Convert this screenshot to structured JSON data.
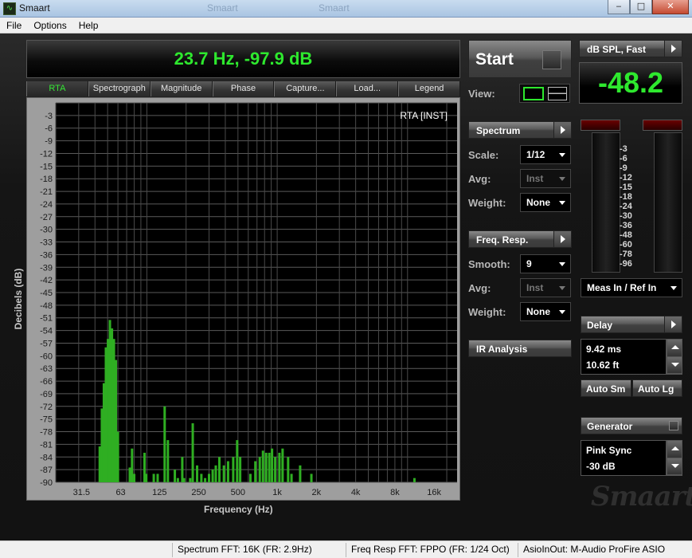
{
  "window": {
    "title": "Smaart",
    "ghost_tabs": [
      "Smaart",
      "Smaart"
    ]
  },
  "menu": [
    "File",
    "Options",
    "Help"
  ],
  "readout": "23.7 Hz, -97.9 dB",
  "tabs": [
    "RTA",
    "Spectrograph",
    "Magnitude",
    "Phase",
    "Capture...",
    "Load...",
    "Legend"
  ],
  "plot": {
    "title": "RTA [INST]",
    "ylabel": "Decibels (dB)",
    "xlabel": "Frequency (Hz)"
  },
  "chart_data": {
    "type": "bar",
    "title": "RTA [INST]",
    "xlabel": "Frequency (Hz)",
    "ylabel": "Decibels (dB)",
    "x_scale": "log",
    "xlim": [
      20,
      24000
    ],
    "ylim": [
      -90,
      0
    ],
    "x_ticks": [
      "31.5",
      "63",
      "125",
      "250",
      "500",
      "1k",
      "2k",
      "4k",
      "8k",
      "16k"
    ],
    "y_ticks": [
      "-3",
      "-6",
      "-9",
      "-12",
      "-15",
      "-18",
      "-21",
      "-24",
      "-27",
      "-30",
      "-33",
      "-36",
      "-39",
      "-42",
      "-45",
      "-48",
      "-51",
      "-54",
      "-57",
      "-60",
      "-63",
      "-66",
      "-69",
      "-72",
      "-75",
      "-78",
      "-81",
      "-84",
      "-87",
      "-90"
    ],
    "grid": true,
    "color": "#2fae22",
    "bars": [
      [
        43.5,
        -81.5
      ],
      [
        45.2,
        -72.5
      ],
      [
        46.8,
        -66.5
      ],
      [
        48.5,
        -58
      ],
      [
        50.3,
        -56
      ],
      [
        52.1,
        -51.5
      ],
      [
        54,
        -53.5
      ],
      [
        55.9,
        -56
      ],
      [
        57.9,
        -61
      ],
      [
        60,
        -78
      ],
      [
        74,
        -86.5
      ],
      [
        77,
        -82
      ],
      [
        80,
        -88
      ],
      [
        96,
        -83
      ],
      [
        99,
        -88
      ],
      [
        113,
        -88
      ],
      [
        121,
        -88
      ],
      [
        137,
        -72
      ],
      [
        145,
        -80
      ],
      [
        164,
        -87
      ],
      [
        173,
        -89
      ],
      [
        187,
        -84
      ],
      [
        193,
        -89
      ],
      [
        215,
        -89
      ],
      [
        225,
        -76
      ],
      [
        243,
        -86
      ],
      [
        262,
        -88
      ],
      [
        280,
        -89
      ],
      [
        300,
        -88
      ],
      [
        320,
        -87
      ],
      [
        338,
        -86
      ],
      [
        360,
        -84
      ],
      [
        390,
        -86
      ],
      [
        420,
        -85
      ],
      [
        460,
        -84
      ],
      [
        493,
        -80
      ],
      [
        520,
        -84
      ],
      [
        623,
        -88
      ],
      [
        680,
        -85
      ],
      [
        735,
        -84
      ],
      [
        778,
        -82.5
      ],
      [
        823,
        -83
      ],
      [
        870,
        -83
      ],
      [
        913,
        -82
      ],
      [
        965,
        -84
      ],
      [
        1040,
        -83
      ],
      [
        1100,
        -82
      ],
      [
        1213,
        -84
      ],
      [
        1288,
        -88
      ],
      [
        1500,
        -86
      ],
      [
        1830,
        -88
      ],
      [
        11300,
        -89
      ]
    ]
  },
  "controls": {
    "start_label": "Start",
    "view_label": "View:",
    "spectrum_label": "Spectrum",
    "scale_label": "Scale:",
    "scale_value": "1/12",
    "avg_label": "Avg:",
    "avg_value": "Inst",
    "weight_label": "Weight:",
    "weight_value": "None",
    "freqresp_label": "Freq. Resp.",
    "smooth_label": "Smooth:",
    "smooth_value": "9",
    "avg2_label": "Avg:",
    "avg2_value": "Inst",
    "weight2_label": "Weight:",
    "weight2_value": "None",
    "ir_label": "IR Analysis"
  },
  "meter": {
    "mode_label": "dB SPL, Fast",
    "value": "-48.2",
    "scale": [
      "-3",
      "-6",
      "-9",
      "-12",
      "-15",
      "-18",
      "-24",
      "-30",
      "-36",
      "-48",
      "-60",
      "-78",
      "-96"
    ],
    "input_label": "Meas In / Ref In"
  },
  "delay": {
    "label": "Delay",
    "ms": "9.42 ms",
    "ft": "10.62 ft",
    "auto_sm": "Auto Sm",
    "auto_lg": "Auto Lg"
  },
  "generator": {
    "label": "Generator",
    "signal": "Pink Sync",
    "level": "-30 dB"
  },
  "logo": "Smaart",
  "status": {
    "spectrum": "Spectrum FFT: 16K (FR: 2.9Hz)",
    "freqresp": "Freq Resp FFT: FPPO (FR: 1/24 Oct)",
    "device": "AsioInOut: M-Audio ProFire ASIO"
  }
}
